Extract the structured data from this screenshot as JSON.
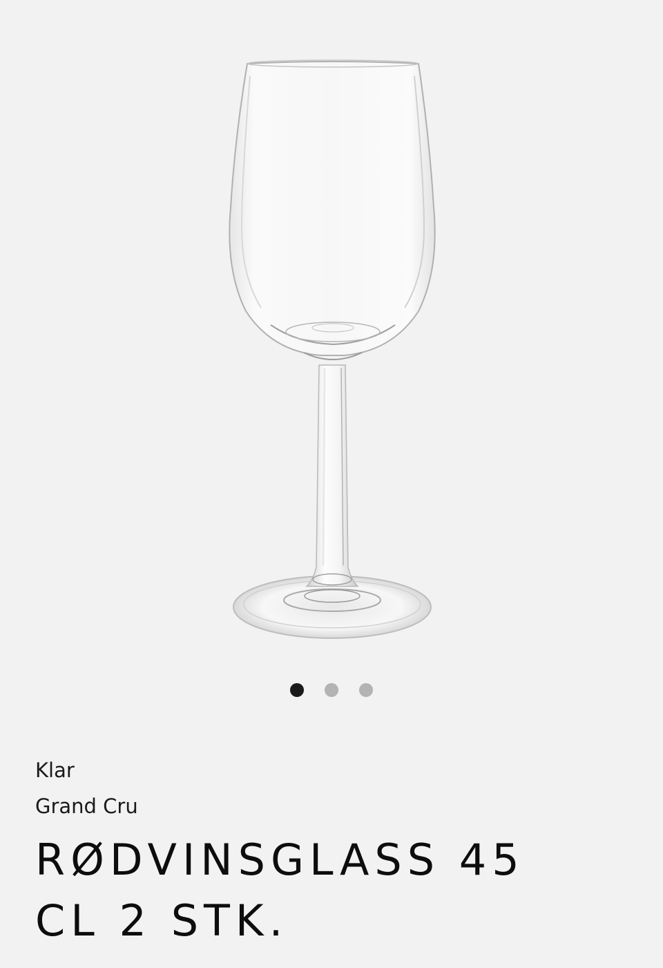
{
  "gallery": {
    "image_alt": "Grand Cru rødvinsglass",
    "slide_count": 3,
    "active_slide": 1,
    "indicator_labels": [
      "1",
      "2",
      "3"
    ]
  },
  "product": {
    "variant": "Klar",
    "collection": "Grand Cru",
    "title": "RØDVINSGLASS 45 CL 2 STK."
  },
  "colors": {
    "background": "#f2f2f2",
    "dot_active": "#1a1a1a",
    "dot_inactive": "#b3b3b3",
    "text": "#111111"
  }
}
